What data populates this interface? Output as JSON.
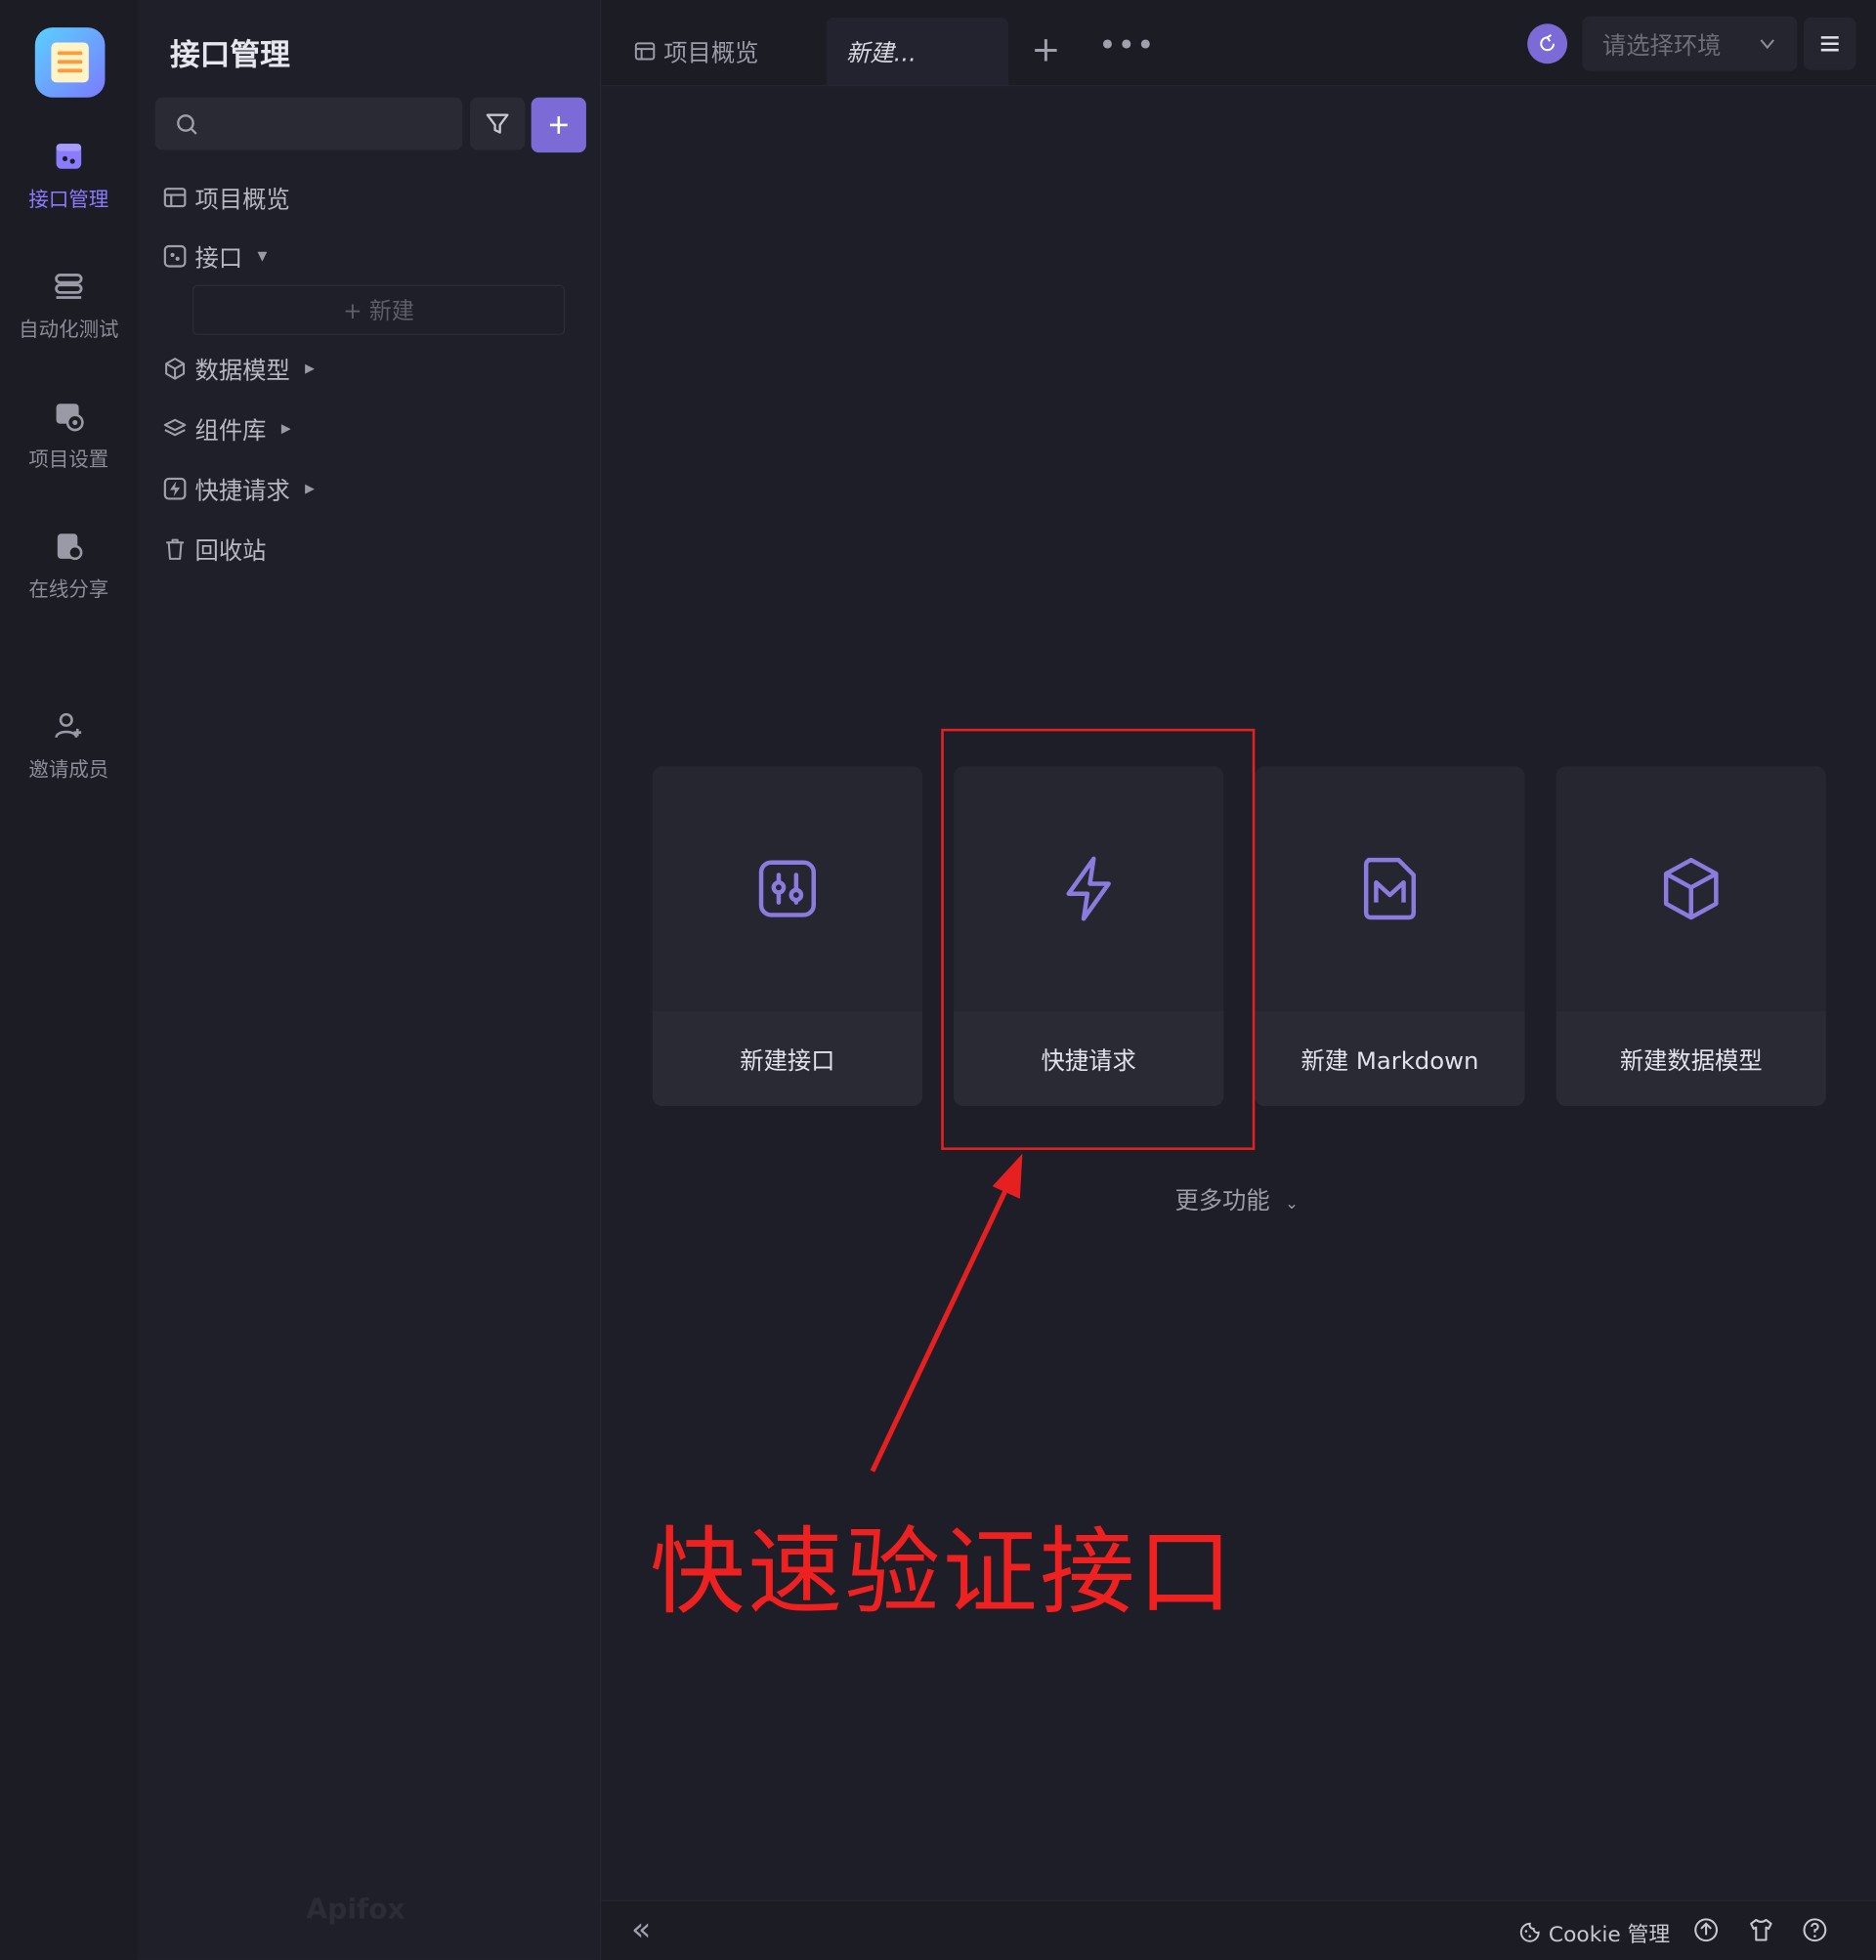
{
  "rail": {
    "items": [
      {
        "label": "接口管理",
        "icon": "api-icon"
      },
      {
        "label": "自动化测试",
        "icon": "automation-icon"
      },
      {
        "label": "项目设置",
        "icon": "settings-icon"
      },
      {
        "label": "在线分享",
        "icon": "share-icon"
      },
      {
        "label": "邀请成员",
        "icon": "invite-user-icon"
      }
    ]
  },
  "sidebar": {
    "title": "接口管理",
    "search_placeholder": "",
    "items": [
      {
        "label": "项目概览",
        "icon": "overview-icon"
      },
      {
        "label": "接口",
        "icon": "api-icon"
      },
      {
        "label": "数据模型",
        "icon": "cube-icon"
      },
      {
        "label": "组件库",
        "icon": "layers-icon"
      },
      {
        "label": "快捷请求",
        "icon": "quick-request-icon"
      },
      {
        "label": "回收站",
        "icon": "trash-icon"
      }
    ],
    "new_label": "+ 新建",
    "watermark": "Apifox"
  },
  "tabs": [
    {
      "label": "项目概览"
    },
    {
      "label": "新建..."
    }
  ],
  "env": {
    "placeholder": "请选择环境"
  },
  "cards": [
    {
      "label": "新建接口",
      "icon": "api-icon"
    },
    {
      "label": "快捷请求",
      "icon": "lightning-icon"
    },
    {
      "label": "新建 Markdown",
      "icon": "markdown-icon"
    },
    {
      "label": "新建数据模型",
      "icon": "cube-icon"
    }
  ],
  "more_label": "更多功能",
  "annotation": {
    "text": "快速验证接口"
  },
  "status": {
    "cookie_label": "Cookie 管理"
  },
  "colors": {
    "accent": "#7c6bd6",
    "annotation": "#ee2020",
    "background": "#1e1e28"
  }
}
